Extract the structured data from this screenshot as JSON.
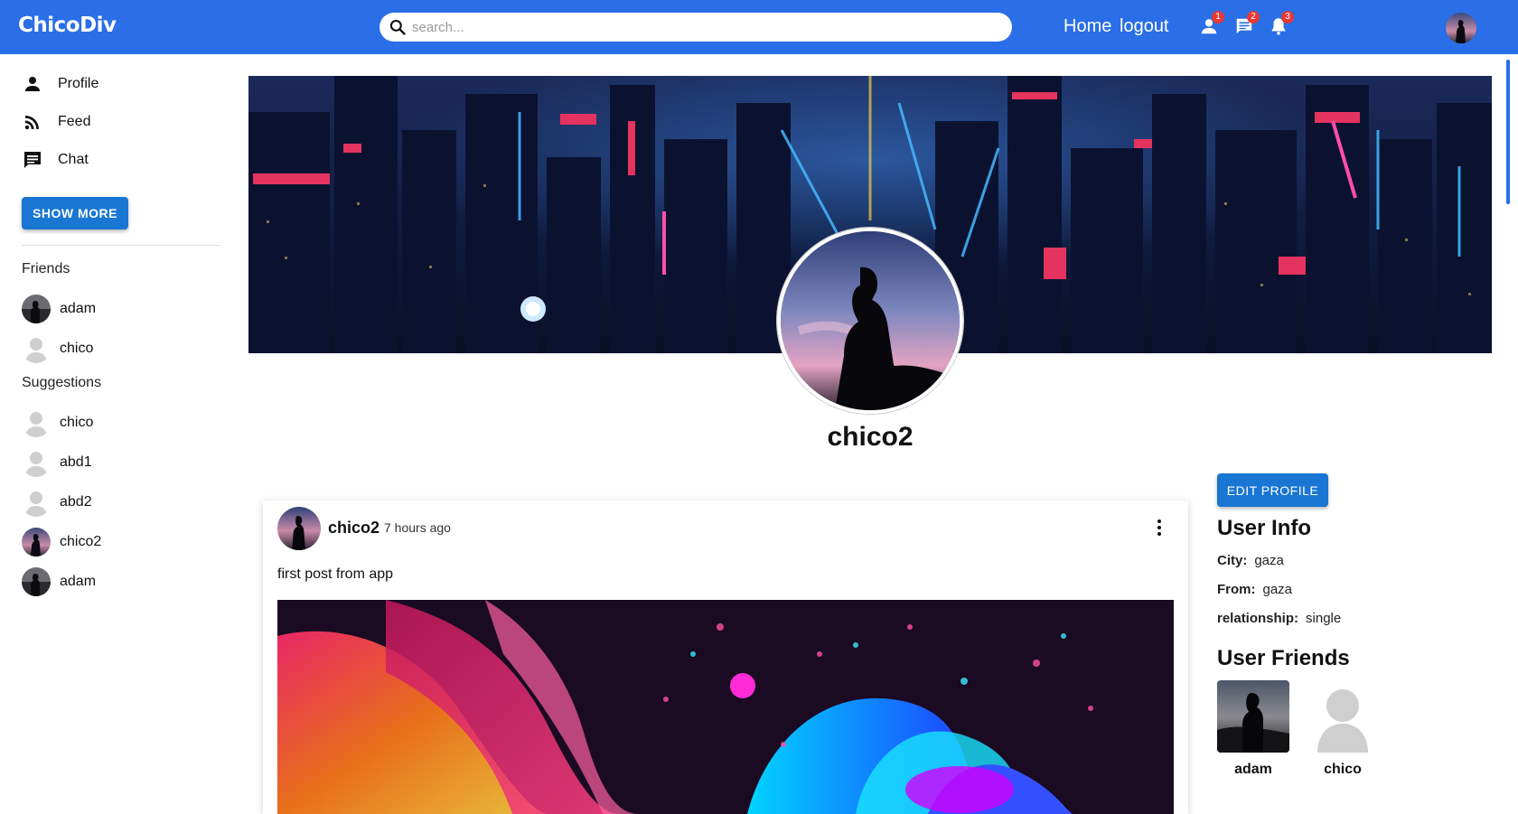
{
  "app": {
    "brand": "ChicoDiv"
  },
  "topbar": {
    "search_placeholder": "search...",
    "nav": {
      "home": "Home",
      "logout": "logout"
    },
    "badges": {
      "friend_requests": "1",
      "messages": "2",
      "notifications": "3"
    },
    "icons": [
      "search-icon",
      "person-icon",
      "chat-icon",
      "bell-icon"
    ],
    "accent": "#2a6ee8"
  },
  "sidebar": {
    "menu": [
      {
        "label": "Profile",
        "icon": "person-icon"
      },
      {
        "label": "Feed",
        "icon": "rss-icon"
      },
      {
        "label": "Chat",
        "icon": "chat-icon"
      }
    ],
    "show_more": "SHOW MORE",
    "friends_heading": "Friends",
    "friends": [
      {
        "name": "adam",
        "avatar": "photo"
      },
      {
        "name": "chico",
        "avatar": "default"
      }
    ],
    "suggestions_heading": "Suggestions",
    "suggestions": [
      {
        "name": "chico",
        "avatar": "default"
      },
      {
        "name": "abd1",
        "avatar": "default"
      },
      {
        "name": "abd2",
        "avatar": "default"
      },
      {
        "name": "chico2",
        "avatar": "photo"
      },
      {
        "name": "adam",
        "avatar": "photo"
      }
    ]
  },
  "profile": {
    "username": "chico2"
  },
  "post": {
    "username": "chico2",
    "time": "7 hours ago",
    "text": "first post from app"
  },
  "user_panel": {
    "edit_button": "EDIT PROFILE",
    "info_title": "User Info",
    "info": [
      {
        "label": "City:",
        "value": "gaza"
      },
      {
        "label": "From:",
        "value": "gaza"
      },
      {
        "label": "relationship:",
        "value": "single"
      }
    ],
    "friends_title": "User Friends",
    "friends": [
      {
        "name": "adam",
        "avatar": "photo"
      },
      {
        "name": "chico",
        "avatar": "default"
      }
    ]
  },
  "colors": {
    "primary_button": "#1976d2",
    "badge": "#e53935"
  }
}
